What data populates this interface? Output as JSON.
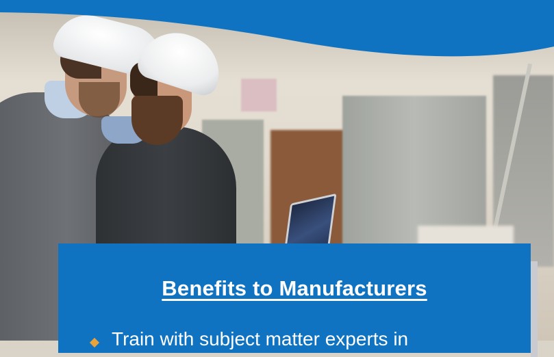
{
  "panel": {
    "title": "Benefits to Manufacturers",
    "bullets": [
      {
        "text": "Train with subject matter experts in"
      }
    ]
  },
  "colors": {
    "brand_blue": "#0f73c2",
    "bullet_accent": "#e8a33a",
    "text": "#ffffff"
  },
  "icons": {
    "bullet": "diamond-bullet-icon"
  }
}
